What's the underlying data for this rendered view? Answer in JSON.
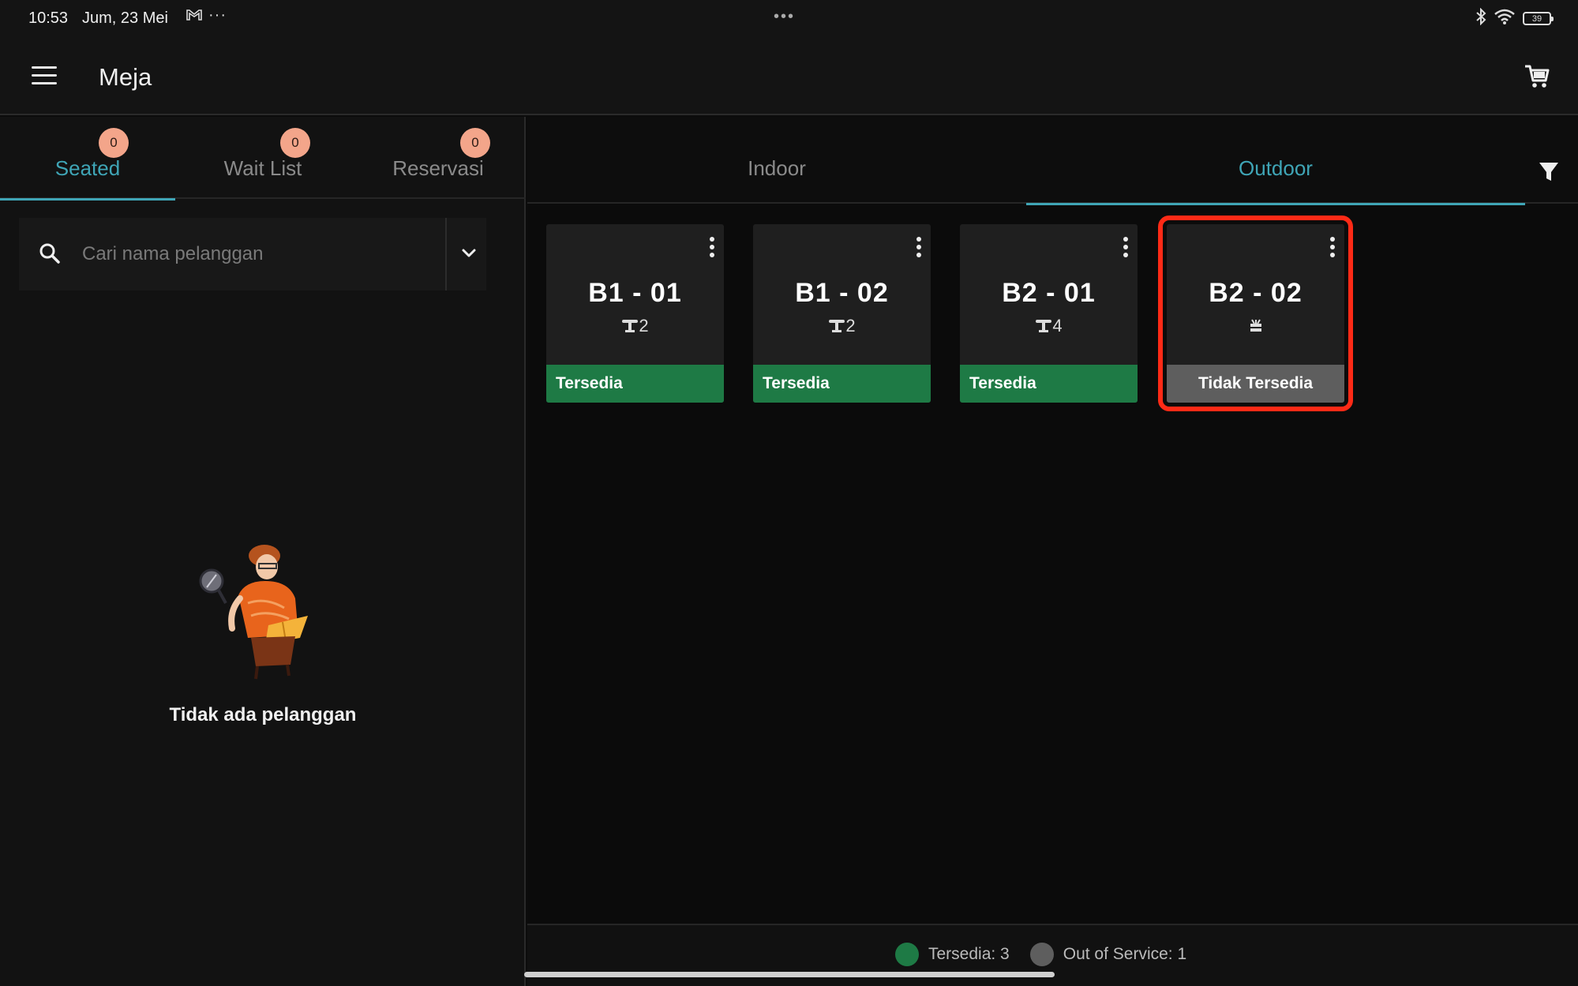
{
  "status_bar": {
    "time": "10:53",
    "date": "Jum, 23 Mei",
    "more": "···",
    "center_dots": "•••",
    "battery": "39"
  },
  "app_bar": {
    "title": "Meja"
  },
  "left_tabs": [
    {
      "label": "Seated",
      "badge": "0",
      "active": true
    },
    {
      "label": "Wait List",
      "badge": "0",
      "active": false
    },
    {
      "label": "Reservasi",
      "badge": "0",
      "active": false
    }
  ],
  "search": {
    "placeholder": "Cari nama pelanggan",
    "value": ""
  },
  "empty_state": {
    "text": "Tidak ada pelanggan"
  },
  "area_tabs": [
    {
      "label": "Indoor",
      "active": false
    },
    {
      "label": "Outdoor",
      "active": true
    }
  ],
  "tables": [
    {
      "name": "B1 - 01",
      "seats": "2",
      "status": "Tersedia"
    },
    {
      "name": "B1 - 02",
      "seats": "2",
      "status": "Tersedia"
    },
    {
      "name": "B2 - 01",
      "seats": "4",
      "status": "Tersedia"
    },
    {
      "name": "B2 - 02",
      "seats": "",
      "status": "Tidak Tersedia"
    }
  ],
  "legend": {
    "available": "Tersedia: 3",
    "out_of_service": "Out of Service: 1"
  },
  "colors": {
    "accent": "#3fa5b6",
    "available": "#1e7a45",
    "unavailable": "#5e5e5e",
    "badge": "#f3a58a",
    "highlight": "#ff2a16"
  }
}
